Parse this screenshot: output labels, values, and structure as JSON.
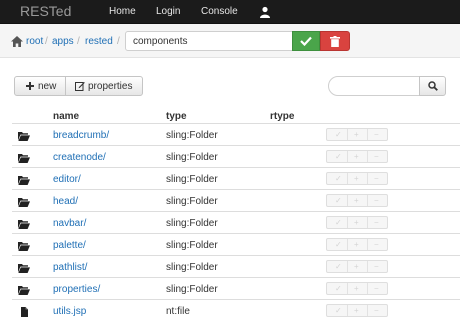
{
  "navbar": {
    "brand": "RESTed",
    "items": [
      "Home",
      "Login",
      "Console"
    ],
    "user_icon": "user-icon"
  },
  "breadcrumb": {
    "home_icon": "home-icon",
    "items": [
      "root",
      "apps",
      "rested"
    ],
    "separator": "/",
    "path_value": "components",
    "ok_icon": "check-icon",
    "delete_icon": "trash-icon"
  },
  "toolbar": {
    "new_label": "new",
    "new_icon": "plus-icon",
    "properties_label": "properties",
    "properties_icon": "edit-icon",
    "search_placeholder": "",
    "search_icon": "search-icon"
  },
  "table": {
    "columns": [
      "name",
      "type",
      "rtype"
    ],
    "rows": [
      {
        "name": "breadcrumb/",
        "type": "sling:Folder",
        "rtype": "",
        "icon": "folder-open-icon"
      },
      {
        "name": "createnode/",
        "type": "sling:Folder",
        "rtype": "",
        "icon": "folder-open-icon"
      },
      {
        "name": "editor/",
        "type": "sling:Folder",
        "rtype": "",
        "icon": "folder-open-icon"
      },
      {
        "name": "head/",
        "type": "sling:Folder",
        "rtype": "",
        "icon": "folder-open-icon"
      },
      {
        "name": "navbar/",
        "type": "sling:Folder",
        "rtype": "",
        "icon": "folder-open-icon"
      },
      {
        "name": "palette/",
        "type": "sling:Folder",
        "rtype": "",
        "icon": "folder-open-icon"
      },
      {
        "name": "pathlist/",
        "type": "sling:Folder",
        "rtype": "",
        "icon": "folder-open-icon"
      },
      {
        "name": "properties/",
        "type": "sling:Folder",
        "rtype": "",
        "icon": "folder-open-icon"
      },
      {
        "name": "utils.jsp",
        "type": "nt:file",
        "rtype": "",
        "icon": "file-icon"
      }
    ],
    "row_action_icons": [
      "check-icon",
      "plus-icon",
      "minus-icon"
    ]
  },
  "colors": {
    "navbar_bg": "#1b1b1b",
    "link": "#1f6fb5",
    "success": "#4aa54a",
    "danger": "#d9433f"
  }
}
